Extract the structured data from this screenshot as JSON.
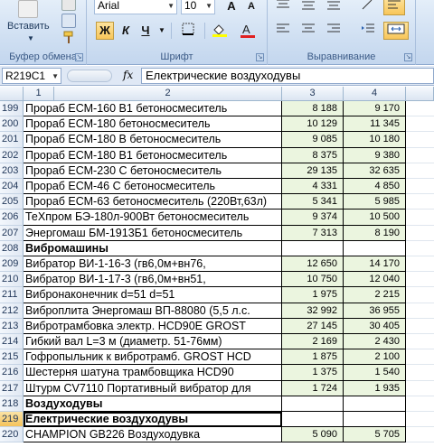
{
  "ribbon": {
    "clipboard": {
      "paste_label": "Вставить",
      "group_label": "Буфер обмена"
    },
    "font": {
      "name": "Arial",
      "size": "10",
      "group_label": "Шрифт",
      "bold": "Ж",
      "italic": "К",
      "underline": "Ч",
      "grow": "A",
      "shrink": "A"
    },
    "alignment": {
      "group_label": "Выравнивание"
    }
  },
  "formula_bar": {
    "name_box": "R219C1",
    "fx": "fx",
    "content": "Електрические воздуходувы"
  },
  "columns": [
    "1",
    "2",
    "3",
    "4"
  ],
  "rows": [
    {
      "num": "199",
      "name": "Прораб ЕСМ-160 В1 бетоносмеситель",
      "v3": "8 188",
      "v4": "9 170"
    },
    {
      "num": "200",
      "name": "Прораб ЕСМ-180 бетоносмеситель",
      "v3": "10 129",
      "v4": "11 345"
    },
    {
      "num": "201",
      "name": "Прораб ЕСМ-180 В бетоносмеситель",
      "v3": "9 085",
      "v4": "10 180"
    },
    {
      "num": "202",
      "name": "Прораб ЕСМ-180 В1 бетоносмеситель",
      "v3": "8 375",
      "v4": "9 380"
    },
    {
      "num": "203",
      "name": "Прораб ЕСМ-230 С бетоносмеситель",
      "v3": "29 135",
      "v4": "32 635"
    },
    {
      "num": "204",
      "name": "Прораб ЕСМ-46 С бетоносмеситель",
      "v3": "4 331",
      "v4": "4 850"
    },
    {
      "num": "205",
      "name": "Прораб ЕСМ-63 бетоносмеситель (220Вт,63л)",
      "v3": "5 341",
      "v4": "5 985"
    },
    {
      "num": "206",
      "name": "ТеХпром БЭ-180л-900Вт  бетоносмеситель",
      "v3": "9 374",
      "v4": "10 500"
    },
    {
      "num": "207",
      "name": "Энергомаш БМ-1913Б1 бетоносмеситель",
      "v3": "7 313",
      "v4": "8 190"
    },
    {
      "num": "208",
      "name": "Вибромашины",
      "v3": "",
      "v4": "",
      "bold": true
    },
    {
      "num": "209",
      "name": "Вибратор ВИ-1-16-3 (гв6,0м+вн76,",
      "v3": "12 650",
      "v4": "14 170"
    },
    {
      "num": "210",
      "name": "Вибратор ВИ-1-17-3 (гв6,0м+вн51,",
      "v3": "10 750",
      "v4": "12 040"
    },
    {
      "num": "211",
      "name": "Вибронаконечник d=51 d=51",
      "v3": "1 975",
      "v4": "2 215"
    },
    {
      "num": "212",
      "name": "Виброплита Энергомаш ВП-88080 (5,5 л.с.",
      "v3": "32 992",
      "v4": "36 955"
    },
    {
      "num": "213",
      "name": "Вибротрамбовка электр.  HCD90E GROST",
      "v3": "27 145",
      "v4": "30 405"
    },
    {
      "num": "214",
      "name": "Гибкий вал L=3 м (диаметр. 51-76мм)",
      "v3": "2 169",
      "v4": "2 430"
    },
    {
      "num": "215",
      "name": "Гофропыльник к вибротрамб. GROST HCD",
      "v3": "1 875",
      "v4": "2 100"
    },
    {
      "num": "216",
      "name": "Шестерня шатуна трамбовщика  HCD90",
      "v3": "1 375",
      "v4": "1 540"
    },
    {
      "num": "217",
      "name": "Штурм CV7110 Портативный вибратор для",
      "v3": "1 724",
      "v4": "1 935"
    },
    {
      "num": "218",
      "name": "Воздуходувы",
      "v3": "",
      "v4": "",
      "bold": true
    },
    {
      "num": "219",
      "name": "Електрические воздуходувы",
      "v3": "",
      "v4": "",
      "bold": true,
      "selected": true
    },
    {
      "num": "220",
      "name": "CHAMPION GB226 Воздуходувка",
      "v3": "5 090",
      "v4": "5 705"
    }
  ]
}
